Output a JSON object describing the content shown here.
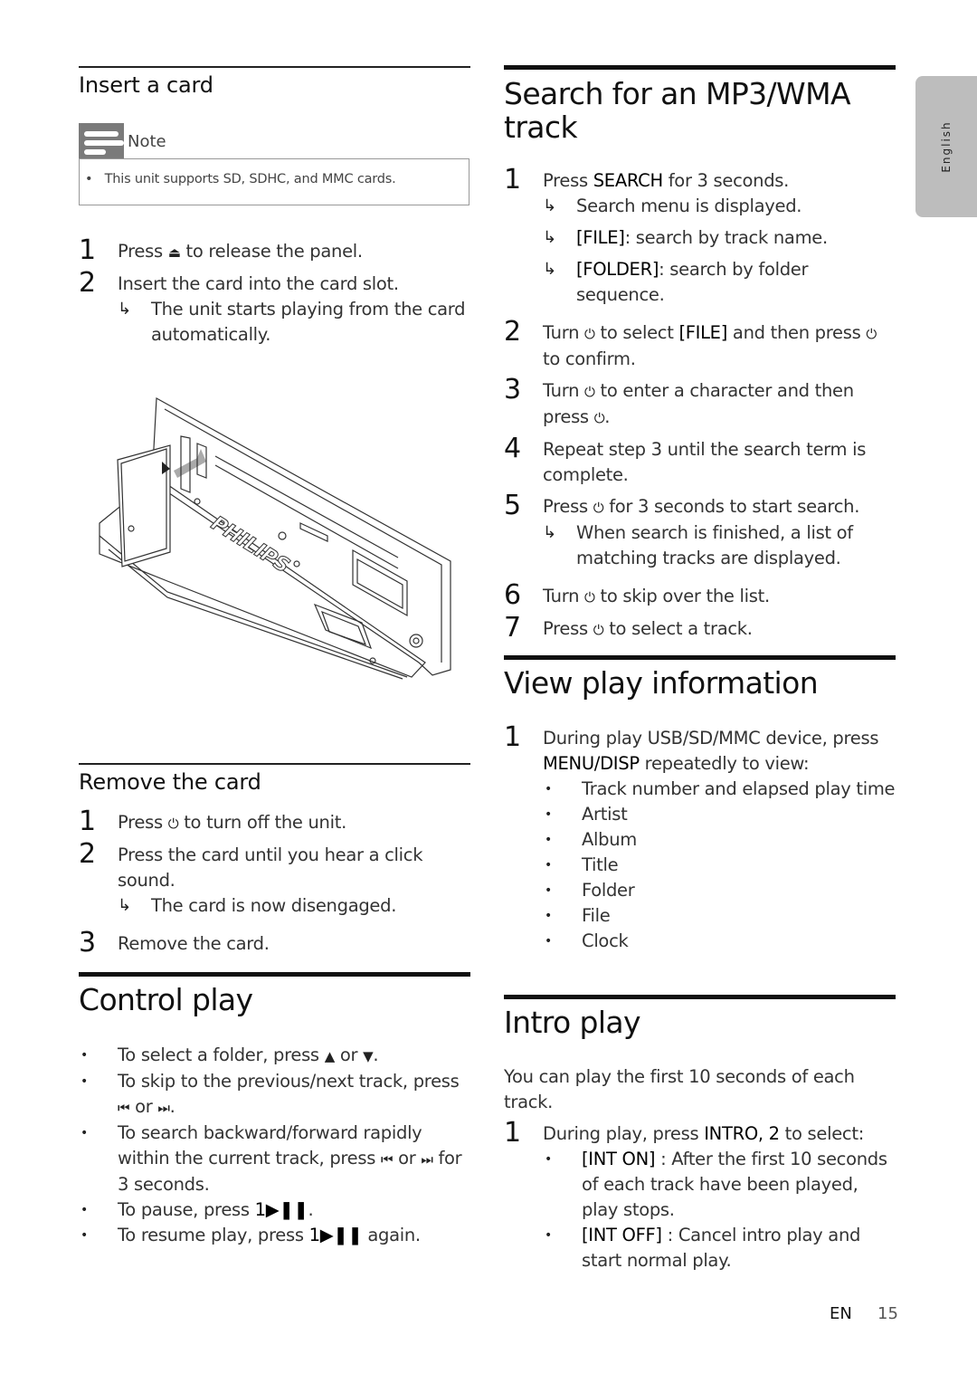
{
  "side_tab": {
    "label": "English"
  },
  "insert_card": {
    "title": "Insert a card",
    "note": {
      "label": "Note",
      "text": "This unit supports SD, SDHC, and MMC cards."
    },
    "steps": [
      {
        "num": "1",
        "pre": "Press ",
        "symbol": "⏏",
        "post": " to release the panel."
      },
      {
        "num": "2",
        "text": "Insert the card into the card slot."
      }
    ],
    "result": "The unit starts playing from the card automatically.",
    "illustration": {
      "brand": "PHILIPS",
      "description": "Detached front panel with SD card being inserted"
    }
  },
  "remove_card": {
    "title": "Remove the card",
    "steps": [
      {
        "num": "1",
        "pre": "Press ",
        "symbol": "⏻",
        "post": " to turn off the unit."
      },
      {
        "num": "2",
        "text": "Press the card until you hear a click sound."
      },
      {
        "num": "3",
        "text": "Remove the card."
      }
    ],
    "result": "The card is now disengaged."
  },
  "control_play": {
    "title": "Control play",
    "bullets": [
      {
        "pre": "To select a folder, press ",
        "sym1": "▲",
        "mid": " or ",
        "sym2": "▼",
        "post": "."
      },
      {
        "pre": "To skip to the previous/next track, press ",
        "sym1": "⏮",
        "mid": " or ",
        "sym2": "⏭",
        "post": "."
      },
      {
        "pre": "To search backward/forward rapidly within the current track, press ",
        "sym1": "⏮",
        "mid": " or ",
        "sym2": "⏭",
        "post": " for 3 seconds."
      },
      {
        "pre": "To pause, press ",
        "key": "1▶❚❚",
        "post": "."
      },
      {
        "pre": "To resume play, press ",
        "key": "1▶❚❚",
        "post": " again."
      }
    ]
  },
  "search": {
    "title": "Search for an MP3/WMA track",
    "step1": {
      "num": "1",
      "pre": "Press ",
      "key": "SEARCH",
      "post": " for 3 seconds."
    },
    "step1_results": [
      {
        "key": "",
        "text": "Search menu is displayed."
      },
      {
        "key": "[FILE]",
        "text": ": search by track name."
      },
      {
        "key": "[FOLDER]",
        "text": ": search by folder sequence."
      }
    ],
    "step2": {
      "num": "2",
      "a": "Turn ",
      "sym": "⏻",
      "b": " to select ",
      "key": "[FILE]",
      "c": "  and then press ",
      "d": " to confirm."
    },
    "step3": {
      "num": "3",
      "text_a": "Turn ",
      "sym": "⏻",
      "text_b": " to enter a character and then press ",
      "text_c": "."
    },
    "step4": {
      "num": "4",
      "text": "Repeat step 3 until the search term is complete."
    },
    "step5": {
      "num": "5",
      "pre": "Press ",
      "sym": "⏻",
      "post": " for 3 seconds to start search."
    },
    "step5_result": "When search is finished, a list of matching tracks are displayed.",
    "step6": {
      "num": "6",
      "pre": "Turn ",
      "sym": "⏻",
      "post": " to skip over the list."
    },
    "step7": {
      "num": "7",
      "pre": "Press ",
      "sym": "⏻",
      "post": " to select a track."
    }
  },
  "view_info": {
    "title": "View play information",
    "step1": {
      "num": "1",
      "pre": "During play USB/SD/MMC device, press ",
      "key": "MENU/DISP",
      "post": " repeatedly to view:"
    },
    "items": [
      "Track number and elapsed play time",
      "Artist",
      "Album",
      "Title",
      "Folder",
      "File",
      "Clock"
    ]
  },
  "intro_play": {
    "title": "Intro play",
    "intro": "You can play the first 10 seconds of each track.",
    "step1": {
      "num": "1",
      "pre": "During play, press ",
      "key": "INTRO, 2",
      "post": " to select:"
    },
    "options": [
      {
        "key": "[INT ON]",
        "text": " : After the first 10 seconds of each track have been played, play stops."
      },
      {
        "key": "[INT OFF]",
        "text": " : Cancel intro play and start normal play."
      }
    ]
  },
  "footer": {
    "lang": "EN",
    "page": "15"
  }
}
